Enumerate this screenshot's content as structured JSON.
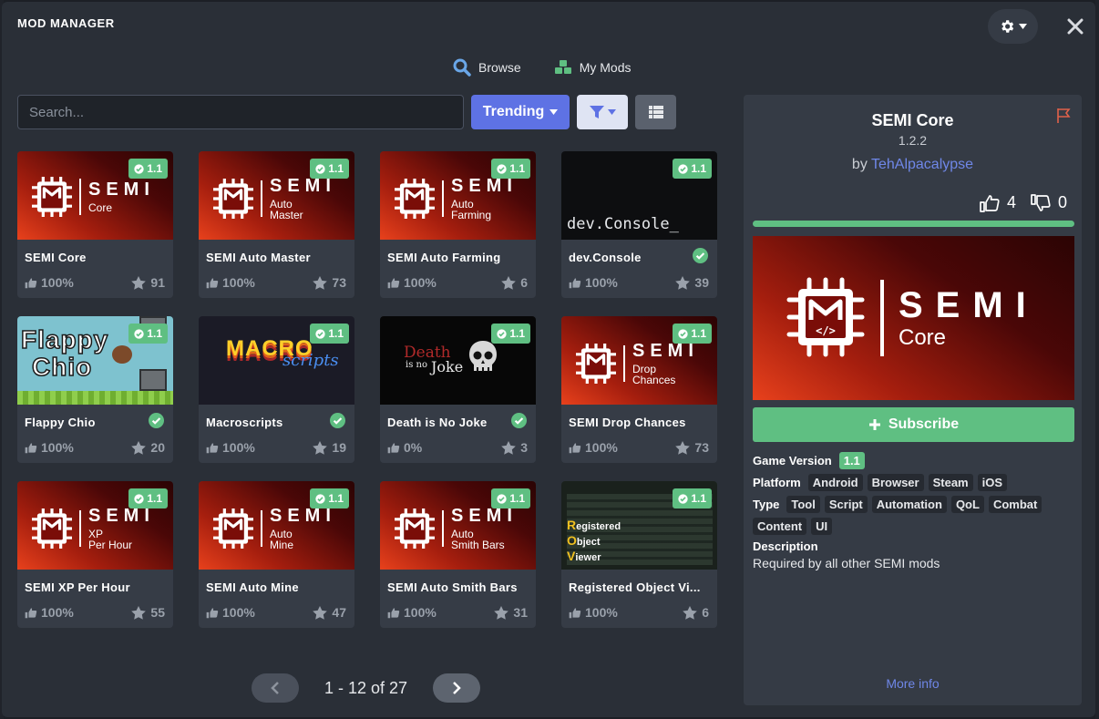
{
  "window": {
    "title": "MOD MANAGER"
  },
  "tabs": [
    {
      "label": "Browse",
      "icon": "search-icon"
    },
    {
      "label": "My Mods",
      "icon": "cubes-icon"
    }
  ],
  "toolbar": {
    "search_placeholder": "Search...",
    "sort_label": "Trending"
  },
  "mods": [
    {
      "name": "SEMI Core",
      "badge": "1.1",
      "rating": "100%",
      "stars": "91",
      "thumb": "semi",
      "sub": [
        "Core"
      ],
      "verified": false
    },
    {
      "name": "SEMI Auto Master",
      "badge": "1.1",
      "rating": "100%",
      "stars": "73",
      "thumb": "semi",
      "sub": [
        "Auto",
        "Master"
      ],
      "verified": false
    },
    {
      "name": "SEMI Auto Farming",
      "badge": "1.1",
      "rating": "100%",
      "stars": "6",
      "thumb": "semi",
      "sub": [
        "Auto",
        "Farming"
      ],
      "verified": false
    },
    {
      "name": "dev.Console",
      "badge": "1.1",
      "rating": "100%",
      "stars": "39",
      "thumb": "console",
      "thumb_text": "dev.Console_",
      "verified": true
    },
    {
      "name": "Flappy Chio",
      "badge": "1.1",
      "rating": "100%",
      "stars": "20",
      "thumb": "flappy",
      "thumb_text": [
        "Flappy",
        "Chio"
      ],
      "verified": true
    },
    {
      "name": "Macroscripts",
      "badge": "1.1",
      "rating": "100%",
      "stars": "19",
      "thumb": "macro",
      "thumb_text": [
        "MACRO",
        "scripts"
      ],
      "verified": true
    },
    {
      "name": "Death is No Joke",
      "badge": "1.1",
      "rating": "0%",
      "stars": "3",
      "thumb": "death",
      "thumb_text": [
        "Death",
        "is no",
        "Joke"
      ],
      "verified": true
    },
    {
      "name": "SEMI Drop Chances",
      "badge": "1.1",
      "rating": "100%",
      "stars": "73",
      "thumb": "semi",
      "sub": [
        "Drop",
        "Chances"
      ],
      "verified": false
    },
    {
      "name": "SEMI XP Per Hour",
      "badge": "1.1",
      "rating": "100%",
      "stars": "55",
      "thumb": "semi",
      "sub": [
        "XP",
        "Per Hour"
      ],
      "verified": false
    },
    {
      "name": "SEMI Auto Mine",
      "badge": "1.1",
      "rating": "100%",
      "stars": "47",
      "thumb": "semi",
      "sub": [
        "Auto",
        "Mine"
      ],
      "verified": false
    },
    {
      "name": "SEMI Auto Smith Bars",
      "badge": "1.1",
      "rating": "100%",
      "stars": "31",
      "thumb": "semi",
      "sub": [
        "Auto",
        "Smith Bars"
      ],
      "verified": false
    },
    {
      "name": "Registered Object Vi...",
      "badge": "1.1",
      "rating": "100%",
      "stars": "6",
      "thumb": "rov",
      "thumb_text": [
        "R",
        "egistered",
        "O",
        "bject",
        "V",
        "iewer"
      ],
      "verified": false
    }
  ],
  "pagination": {
    "text": "1 - 12 of 27"
  },
  "details": {
    "title": "SEMI Core",
    "version": "1.2.2",
    "by": "by",
    "author": "TehAlpacalypse",
    "likes": "4",
    "dislikes": "0",
    "likes_ratio": 1.0,
    "banner_big": "SEMI",
    "banner_sub": "Core",
    "subscribe_label": "Subscribe",
    "game_version_label": "Game Version",
    "game_version": "1.1",
    "platform_label": "Platform",
    "platforms": [
      "Android",
      "Browser",
      "Steam",
      "iOS"
    ],
    "type_label": "Type",
    "types": [
      "Tool",
      "Script",
      "Automation",
      "QoL",
      "Combat",
      "Content",
      "UI"
    ],
    "description_label": "Description",
    "description": "Required by all other SEMI mods",
    "more_info": "More info"
  },
  "colors": {
    "accent": "#5e72e4",
    "success": "#5fbf82",
    "panel": "#2a2f37",
    "card": "#363c46",
    "link": "#6f87e8"
  }
}
